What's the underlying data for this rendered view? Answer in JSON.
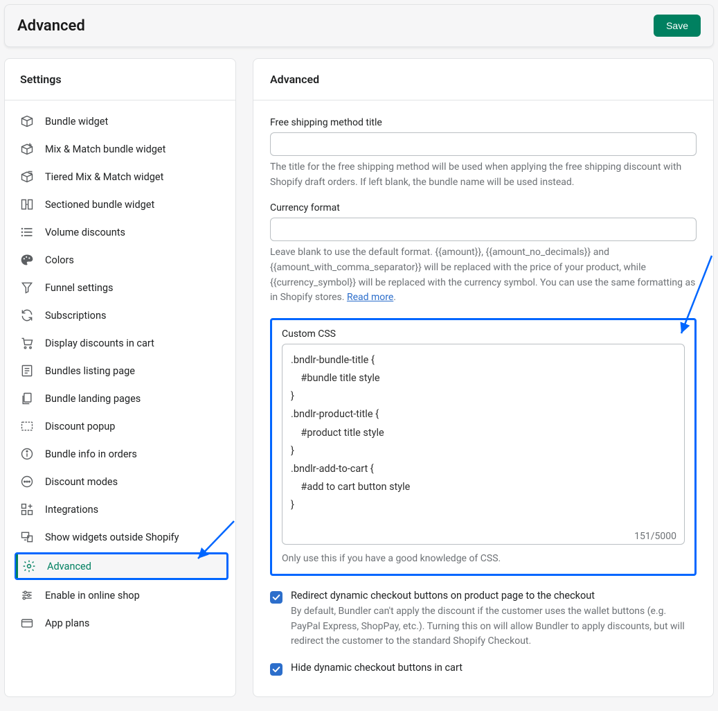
{
  "header": {
    "title": "Advanced",
    "save_label": "Save"
  },
  "sidebar": {
    "title": "Settings",
    "items": [
      {
        "label": "Bundle widget"
      },
      {
        "label": "Mix & Match bundle widget"
      },
      {
        "label": "Tiered Mix & Match widget"
      },
      {
        "label": "Sectioned bundle widget"
      },
      {
        "label": "Volume discounts"
      },
      {
        "label": "Colors"
      },
      {
        "label": "Funnel settings"
      },
      {
        "label": "Subscriptions"
      },
      {
        "label": "Display discounts in cart"
      },
      {
        "label": "Bundles listing page"
      },
      {
        "label": "Bundle landing pages"
      },
      {
        "label": "Discount popup"
      },
      {
        "label": "Bundle info in orders"
      },
      {
        "label": "Discount modes"
      },
      {
        "label": "Integrations"
      },
      {
        "label": "Show widgets outside Shopify"
      },
      {
        "label": "Advanced"
      },
      {
        "label": "Enable in online shop"
      },
      {
        "label": "App plans"
      }
    ],
    "active_index": 16
  },
  "main": {
    "title": "Advanced",
    "free_shipping": {
      "label": "Free shipping method title",
      "value": "",
      "help": "The title for the free shipping method will be used when applying the free shipping discount with Shopify draft orders. If left blank, the bundle name will be used instead."
    },
    "currency_format": {
      "label": "Currency format",
      "value": "",
      "help": "Leave blank to use the default format. {{amount}}, {{amount_no_decimals}} and {{amount_with_comma_separator}} will be replaced with the price of your product, while {{currency_symbol}} will be replaced with the currency symbol. You can use the same formatting as in Shopify stores. ",
      "read_more": "Read more"
    },
    "custom_css": {
      "label": "Custom CSS",
      "value": ".bndlr-bundle-title {\n    #bundle title style\n}\n.bndlr-product-title {\n    #product title style\n}\n.bndlr-add-to-cart {\n    #add to cart button style\n}",
      "count": "151/5000",
      "help": "Only use this if you have a good knowledge of CSS."
    },
    "redirect_checkout": {
      "label": "Redirect dynamic checkout buttons on product page to the checkout",
      "help": "By default, Bundler can't apply the discount if the customer uses the wallet buttons (e.g. PayPal Express, ShopPay, etc.). Turning this on will allow Bundler to apply discounts, but will redirect the customer to the standard Shopify Checkout.",
      "checked": true
    },
    "hide_checkout": {
      "label": "Hide dynamic checkout buttons in cart",
      "checked": true
    }
  }
}
